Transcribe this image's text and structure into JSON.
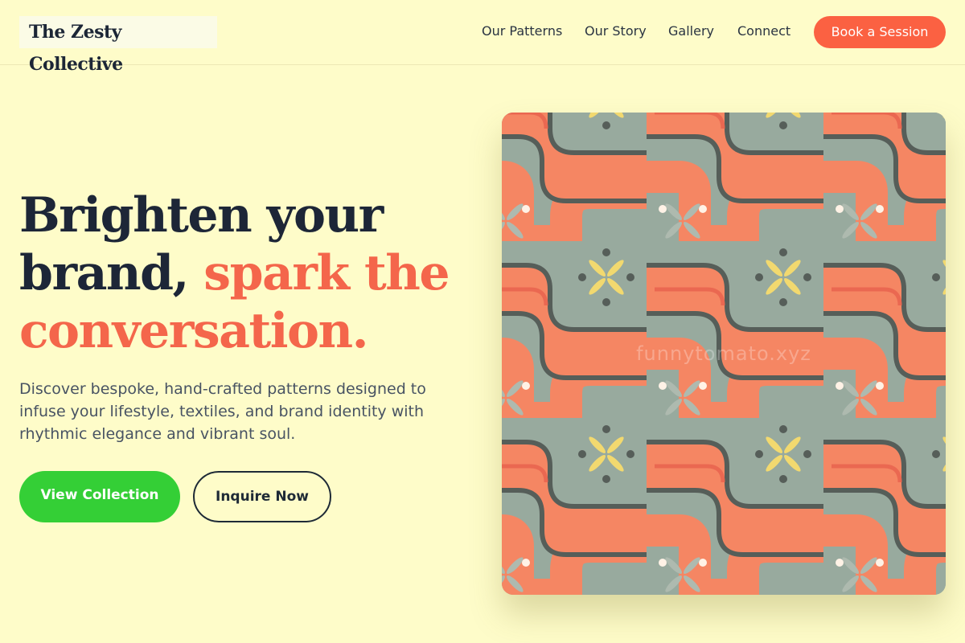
{
  "brand": {
    "name": "The Zesty Collective"
  },
  "nav": {
    "items": [
      {
        "label": "Our Patterns"
      },
      {
        "label": "Our Story"
      },
      {
        "label": "Gallery"
      },
      {
        "label": "Connect"
      }
    ],
    "cta_label": "Book a Session"
  },
  "hero": {
    "headline_part1": "Brighten your brand,",
    "headline_part2": "spark the conversation.",
    "description": "Discover bespoke, hand-crafted patterns designed to infuse your lifestyle, textiles, and brand identity with rhythmic elegance and vibrant soul.",
    "primary_button": "View Collection",
    "secondary_button": "Inquire Now",
    "image_watermark": "funnytomato.xyz"
  },
  "colors": {
    "background": "#fefcc9",
    "accent_coral": "#f4664b",
    "button_coral": "#fb6142",
    "button_green": "#34cf36",
    "text_dark": "#1d2637",
    "pattern_sage": "#92a69c",
    "pattern_orange": "#f5805d",
    "pattern_yellow": "#f2d86a"
  }
}
